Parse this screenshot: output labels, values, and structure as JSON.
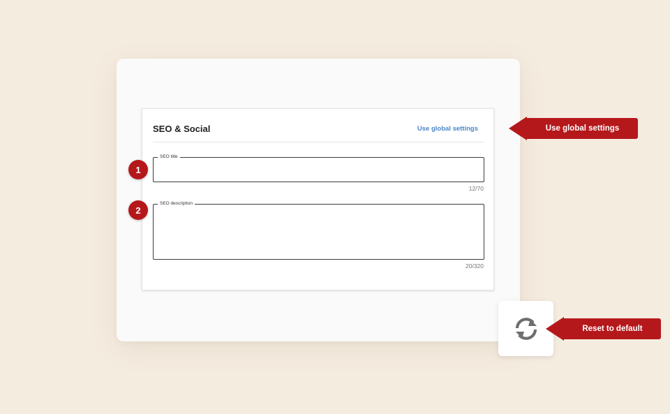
{
  "panel": {
    "title": "SEO & Social",
    "global_link": "Use global settings"
  },
  "fields": {
    "seo_title": {
      "label": "SEO title",
      "value": "",
      "counter": "12/70"
    },
    "seo_description": {
      "label": "SEO description",
      "value": "",
      "counter": "20/320"
    }
  },
  "steps": [
    "1",
    "2"
  ],
  "callouts": {
    "global": "Use global settings",
    "reset": "Reset to default"
  },
  "reset_button": {
    "icon": "refresh-icon"
  },
  "colors": {
    "background": "#f5ece0",
    "accent_red": "#b5181b",
    "link_blue": "#4a86c8",
    "icon_gray": "#6e6e6e"
  }
}
